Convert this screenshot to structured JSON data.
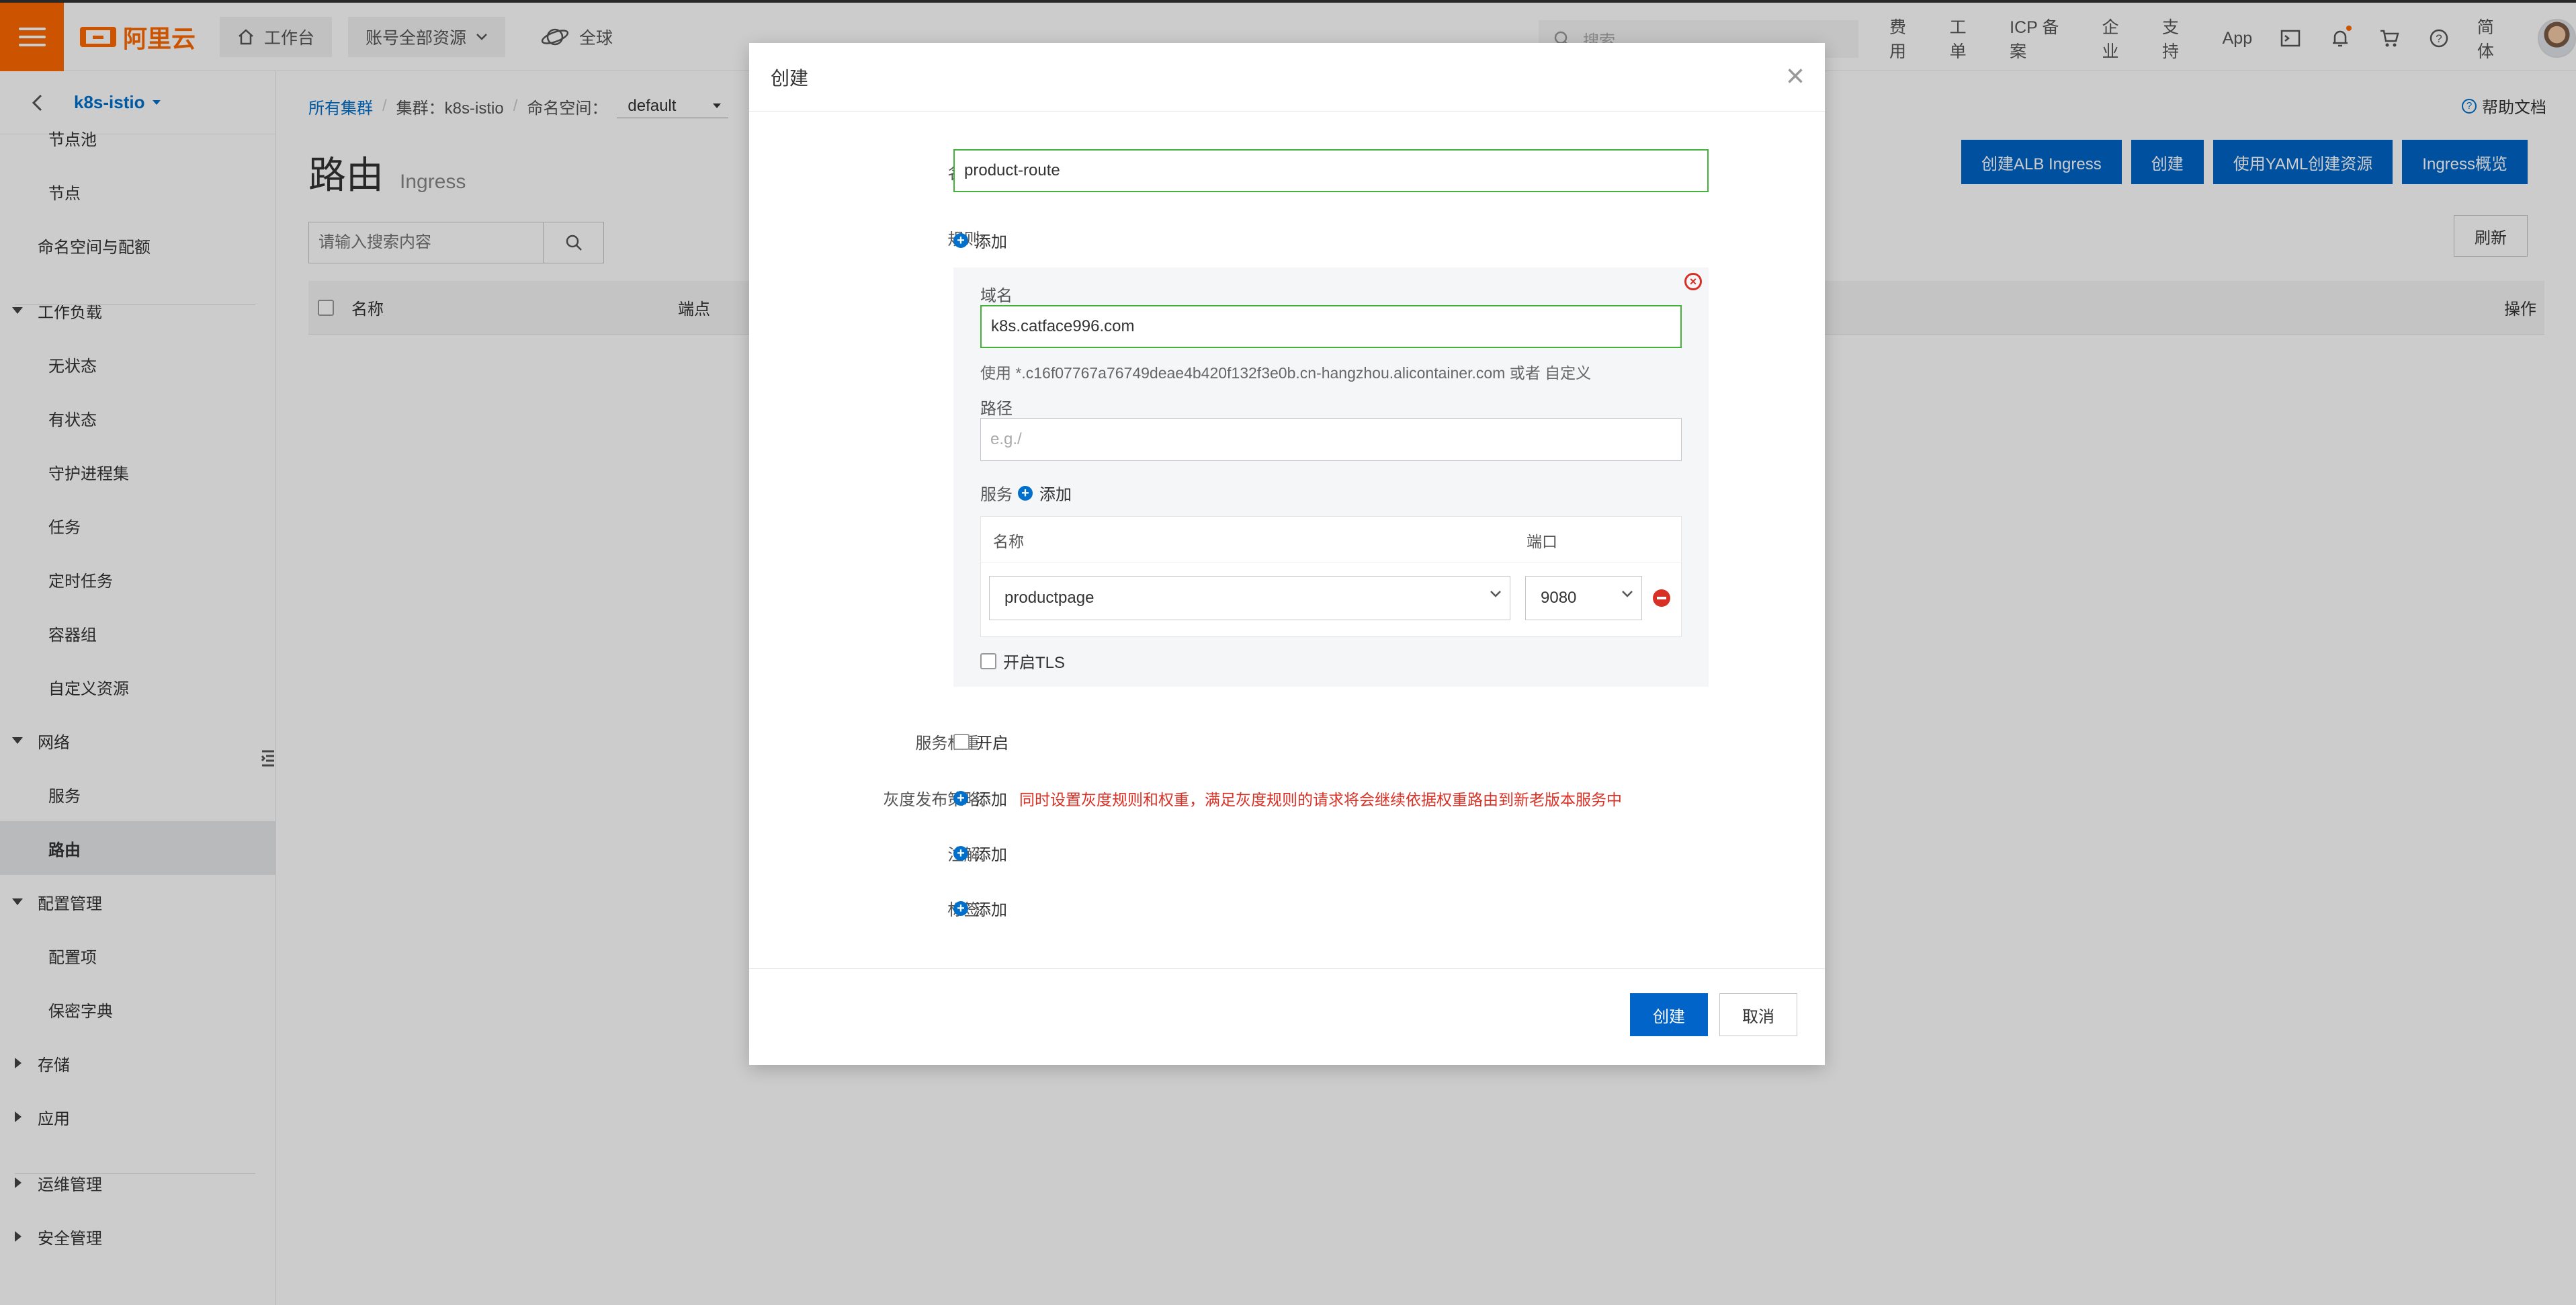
{
  "topbar": {
    "logo_text": "阿里云",
    "workbench": "工作台",
    "account_scope": "账号全部资源",
    "region": "全球",
    "search_placeholder": "搜索...",
    "links": [
      "费用",
      "工单",
      "ICP 备案",
      "企业",
      "支持",
      "App"
    ],
    "language": "简体"
  },
  "sidebar": {
    "cluster_name": "k8s-istio",
    "items": [
      {
        "label": "节点池",
        "kind": "sub"
      },
      {
        "label": "节点",
        "kind": "sub"
      },
      {
        "label": "命名空间与配额",
        "kind": "plain"
      },
      {
        "label": "工作负载",
        "kind": "group-open"
      },
      {
        "label": "无状态",
        "kind": "sub"
      },
      {
        "label": "有状态",
        "kind": "sub"
      },
      {
        "label": "守护进程集",
        "kind": "sub"
      },
      {
        "label": "任务",
        "kind": "sub"
      },
      {
        "label": "定时任务",
        "kind": "sub"
      },
      {
        "label": "容器组",
        "kind": "sub"
      },
      {
        "label": "自定义资源",
        "kind": "sub"
      },
      {
        "label": "网络",
        "kind": "group-open"
      },
      {
        "label": "服务",
        "kind": "sub"
      },
      {
        "label": "路由",
        "kind": "sub-active"
      },
      {
        "label": "配置管理",
        "kind": "group-open"
      },
      {
        "label": "配置项",
        "kind": "sub"
      },
      {
        "label": "保密字典",
        "kind": "sub"
      },
      {
        "label": "存储",
        "kind": "group-closed"
      },
      {
        "label": "应用",
        "kind": "group-closed"
      },
      {
        "label": "运维管理",
        "kind": "group-closed"
      },
      {
        "label": "安全管理",
        "kind": "group-closed"
      }
    ]
  },
  "breadcrumb": {
    "all_clusters": "所有集群",
    "cluster": "集群：k8s-istio",
    "namespace_label": "命名空间：",
    "namespace_value": "default"
  },
  "page": {
    "title": "路由",
    "subtitle": "Ingress",
    "help_doc": "帮助文档",
    "search_placeholder": "请输入搜索内容",
    "refresh": "刷新",
    "buttons": {
      "create_alb": "创建ALB Ingress",
      "create": "创建",
      "create_yaml": "使用YAML创建资源",
      "ingress_overview": "Ingress概览"
    },
    "table_columns": {
      "name": "名称",
      "endpoint": "端点",
      "actions": "操作"
    }
  },
  "modal": {
    "title": "创建",
    "name_label": "名称:",
    "name_value": "product-route",
    "rules_label": "规则:",
    "add": "添加",
    "domain_label": "域名",
    "domain_value": "k8s.catface996.com",
    "domain_hint_prefix": "使用 *.c16f07767a76749deae4b420f132f3e0b.cn-hangzhou.alicontainer.com 或者",
    "domain_hint_link": "自定义",
    "path_label": "路径",
    "path_placeholder": "e.g./",
    "service_label": "服务",
    "service_col_name": "名称",
    "service_col_port": "端口",
    "service_name_value": "productpage",
    "service_port_value": "9080",
    "tls_label": "开启TLS",
    "weight_label": "服务权重:",
    "weight_enable": "开启",
    "canary_label": "灰度发布策略:",
    "canary_warning": "同时设置灰度规则和权重，满足灰度规则的请求将会继续依据权重路由到新老版本服务中",
    "annotations_label": "注解:",
    "labels_label": "标签:",
    "submit": "创建",
    "cancel": "取消"
  }
}
